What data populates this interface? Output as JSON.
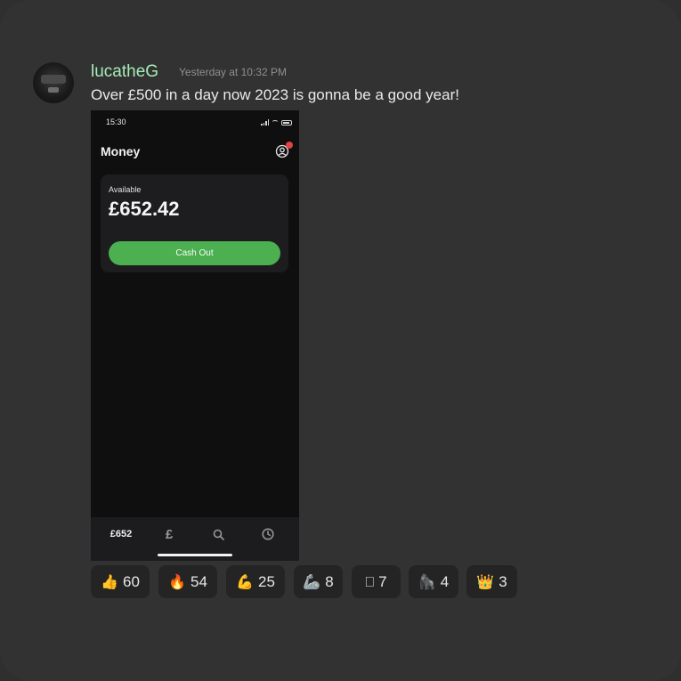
{
  "message": {
    "username": "lucatheG",
    "timestamp": "Yesterday at 10:32 PM",
    "text": "Over £500 in a day now 2023 is gonna be a good year!"
  },
  "screenshot": {
    "status_time": "15:30",
    "app_title": "Money",
    "available_label": "Available",
    "balance": "£652.42",
    "cash_out_label": "Cash Out",
    "tabs": {
      "balance_tab": "£652",
      "pound_tab": "£"
    }
  },
  "reactions": [
    {
      "emoji": "👍",
      "count": "60",
      "icon": "thumbs-up-icon"
    },
    {
      "emoji": "🔥",
      "count": "54",
      "icon": "fire-icon"
    },
    {
      "emoji": "💪",
      "count": "25",
      "icon": "flexed-biceps-icon"
    },
    {
      "emoji": "🦾",
      "count": "8",
      "icon": "mechanical-arm-icon"
    },
    {
      "emoji": "⎕",
      "count": "7",
      "icon": "unknown-glyph-icon"
    },
    {
      "emoji": "🦍",
      "count": "4",
      "icon": "gorilla-icon"
    },
    {
      "emoji": "👑",
      "count": "3",
      "icon": "crown-icon"
    }
  ],
  "colors": {
    "username": "#a6ecb7",
    "cash_out_button": "#4caf50",
    "notification_badge": "#e24242"
  }
}
